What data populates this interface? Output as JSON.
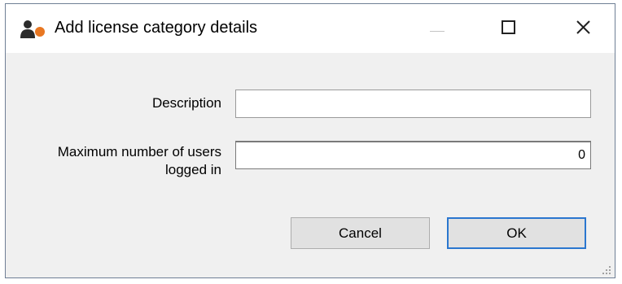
{
  "window": {
    "title": "Add license category details",
    "icons": {
      "app": "license-app-icon",
      "minimize": "minimize-icon",
      "maximize": "maximize-icon",
      "close": "close-icon",
      "resize": "resize-grip-icon"
    }
  },
  "form": {
    "description": {
      "label": "Description",
      "value": ""
    },
    "max_users": {
      "label_line1": "Maximum number of users",
      "label_line2": "logged in",
      "value": "0"
    }
  },
  "buttons": {
    "cancel_label": "Cancel",
    "ok_label": "OK"
  },
  "colors": {
    "dialog_background": "#f0f0f0",
    "title_background": "#ffffff",
    "default_button_border": "#2a76cf",
    "icon_accent": "#e87722"
  }
}
